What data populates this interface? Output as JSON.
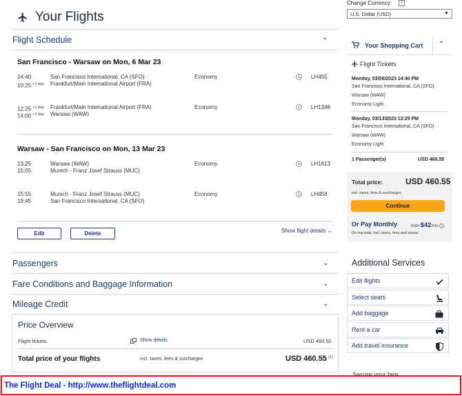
{
  "header": {
    "title": "Your Flights"
  },
  "currency": {
    "label": "Change Currency:",
    "info": "i",
    "selected": "U.S. Dollar (USD)"
  },
  "flight_schedule": {
    "title": "Flight Schedule",
    "journeys": [
      {
        "title": "San Francisco - Warsaw on Mon, 6 Mar 23",
        "segments": [
          {
            "dep_time": "14:40",
            "dep_offset": "",
            "arr_time": "10:25",
            "arr_offset": "+1 day",
            "from": "San Francisco International, CA (SFO)",
            "to": "Frankfurt/Main International Airport (FRA)",
            "cabin": "Economy",
            "flight": "LH455"
          },
          {
            "dep_time": "12:25",
            "dep_offset": "+1 day",
            "arr_time": "14:00",
            "arr_offset": "+1 day",
            "from": "Frankfurt/Main International Airport (FRA)",
            "to": "Warsaw (WAW)",
            "cabin": "Economy",
            "flight": "LH1348"
          }
        ]
      },
      {
        "title": "Warsaw - San Francisco on Mon, 13 Mar 23",
        "segments": [
          {
            "dep_time": "13:25",
            "dep_offset": "",
            "arr_time": "15:05",
            "arr_offset": "",
            "from": "Warsaw (WAW)",
            "to": "Munich - Franz Josef Strauss (MUC)",
            "cabin": "Economy",
            "flight": "LH1613"
          },
          {
            "dep_time": "15:55",
            "dep_offset": "",
            "arr_time": "19:45",
            "arr_offset": "",
            "from": "Munich - Franz Josef Strauss (MUC)",
            "to": "San Francisco International, CA (SFO)",
            "cabin": "Economy",
            "flight": "LH458"
          }
        ]
      }
    ],
    "edit_label": "Edit",
    "delete_label": "Delete",
    "details_label": "Show flight details"
  },
  "sections": {
    "passengers": "Passengers",
    "fare": "Fare Conditions and Baggage Information",
    "mileage": "Mileage Credit"
  },
  "price_overview": {
    "title": "Price Overview",
    "tickets_label": "Flight tickets",
    "show_details": "Show details",
    "tickets_value": "USD 460.55",
    "total_label": "Total price of your flights",
    "total_note": "incl. taxes, fees & surcharges",
    "total_value": "USD 460.55",
    "total_footnote": "(1)"
  },
  "cart": {
    "title": "Your Shopping Cart",
    "tickets_label": "Flight Tickets",
    "outbound": {
      "date": "Monday, 03/06/2023 14:40 PM",
      "from": "San Francisco International, CA (SFO)",
      "to": "Warsaw (WAW)",
      "fare": "Economy Light"
    },
    "inbound": {
      "date": "Monday, 03/13/2023 13:25 PM",
      "from": "Warsaw (WAW)",
      "to": "San Francisco International, CA (SFO)",
      "fare": "Economy Light"
    },
    "passengers": "1 Passenger(s)",
    "passengers_value": "USD 460.55",
    "total_label": "Total price:",
    "total_value": "USD 460.55",
    "total_note": "incl. taxes, fees & surcharges",
    "continue_label": "Continue",
    "monthly_label": "Or Pay Monthly",
    "monthly_from": "from",
    "monthly_amount": "$42",
    "monthly_unit": "/mo",
    "monthly_note": "On trip total, incl. taxes, fees and extras"
  },
  "additional_services": {
    "title": "Additional Services",
    "items": [
      {
        "label": "Edit flights",
        "icon": "check-icon"
      },
      {
        "label": "Select seats",
        "icon": "seat-icon"
      },
      {
        "label": "Add baggage",
        "icon": "baggage-icon"
      },
      {
        "label": "Rent a car",
        "icon": "car-icon"
      },
      {
        "label": "Add travel insurance",
        "icon": "shield-icon"
      }
    ]
  },
  "secure_text": "Secure your fare",
  "banner": {
    "text": "The Flight Deal - http://www.theflightdeal.com",
    "border_color": "#e0141e",
    "text_color": "#1a22c8"
  },
  "colors": {
    "accent": "#1c3a63",
    "continue": "#f7a51b"
  }
}
